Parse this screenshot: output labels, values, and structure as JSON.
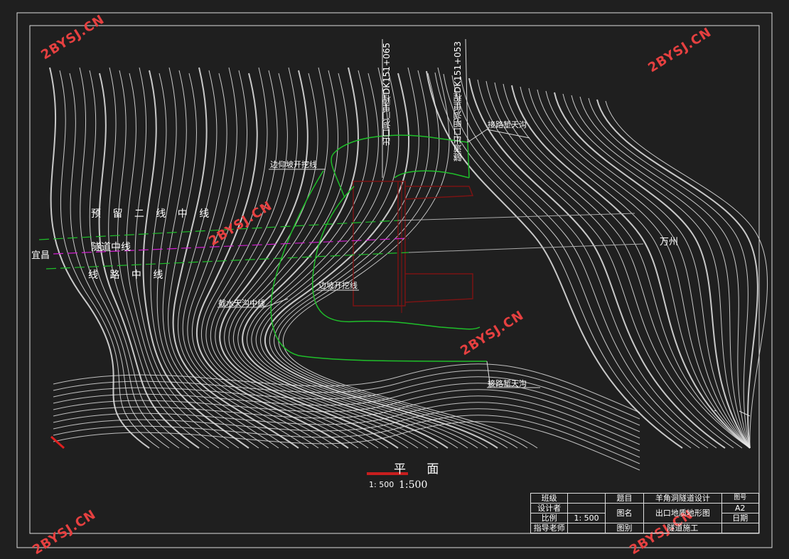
{
  "watermarks": [
    "2BYSJ.CN",
    "2BYSJ.CN",
    "2BYSJ.CN",
    "2BYSJ.CN",
    "2BYSJ.CN",
    "2BYSJ.CN"
  ],
  "labels": {
    "reserved_line": "预 留 二 线 中 线",
    "tunnel_centerline": "隧道中线",
    "route_centerline": "线 路 中 线",
    "yichang": "宜昌",
    "wanzhou": "万州",
    "slope_excavation_top": "边仰坡开挖线",
    "slope_excavation": "边坡开挖线",
    "drain_ditch_centerline": "截水天沟中线",
    "ditch_top": "接路堑天沟",
    "ditch_bottom": "接路堑天沟",
    "exit_mileage_1": "出口洞门里程DK151+065",
    "exit_mileage_2": "隧道出口明洞里程DK151+053"
  },
  "plan_title": "平 面",
  "scale_small": "1: 500",
  "scale_large": "1:500",
  "title_block": {
    "class_label": "班级",
    "designer_label": "设计者",
    "scale_label": "比例",
    "scale_value": "1: 500",
    "advisor_label": "指导老师",
    "topic_label": "题目",
    "topic_value": "羊角洞隧道设计",
    "drawing_name_label": "图名",
    "drawing_name_value": "出口地质地形图",
    "category_label": "图别",
    "category_value": "隧道施工",
    "sheet_label": "图号",
    "sheet_value": "A2",
    "date_label": "日期"
  },
  "colors": {
    "background": "#1f1f1f",
    "contour": "#e8e8e8",
    "excavation_line": "#1fbf2a",
    "tunnel_line": "#d11fd1",
    "portal_outline": "#7a1414",
    "watermark": "#e64040"
  }
}
